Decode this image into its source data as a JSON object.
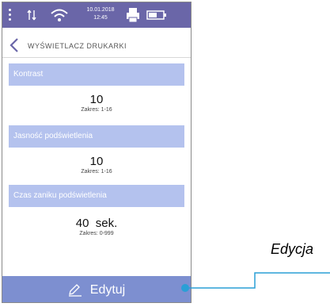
{
  "statusbar": {
    "date": "10.01.2018",
    "time": "12:45",
    "icons": [
      "menu-dots-icon",
      "signal-arrows-icon",
      "wifi-icon",
      "printer-icon",
      "battery-icon"
    ]
  },
  "header": {
    "title": "WYŚWIETLACZ DRUKARKI",
    "back_icon": "chevron-left-icon"
  },
  "settings": [
    {
      "label": "Kontrast",
      "value": "10",
      "range": "Zakres: 1-16"
    },
    {
      "label": "Jasność podświetlenia",
      "value": "10",
      "range": "Zakres: 1-16"
    },
    {
      "label": "Czas zaniku podświetlenia",
      "value": "40  sek.",
      "range": "Zakres: 0-999"
    }
  ],
  "edit_button": {
    "label": "Edytuj",
    "icon": "pencil-icon"
  },
  "callout": {
    "label": "Edycja"
  },
  "colors": {
    "statusbar": "#6a66a8",
    "section_band": "#b4c2ee",
    "edit_bar": "#7d8fd0",
    "callout_line": "#2a9fd6"
  }
}
